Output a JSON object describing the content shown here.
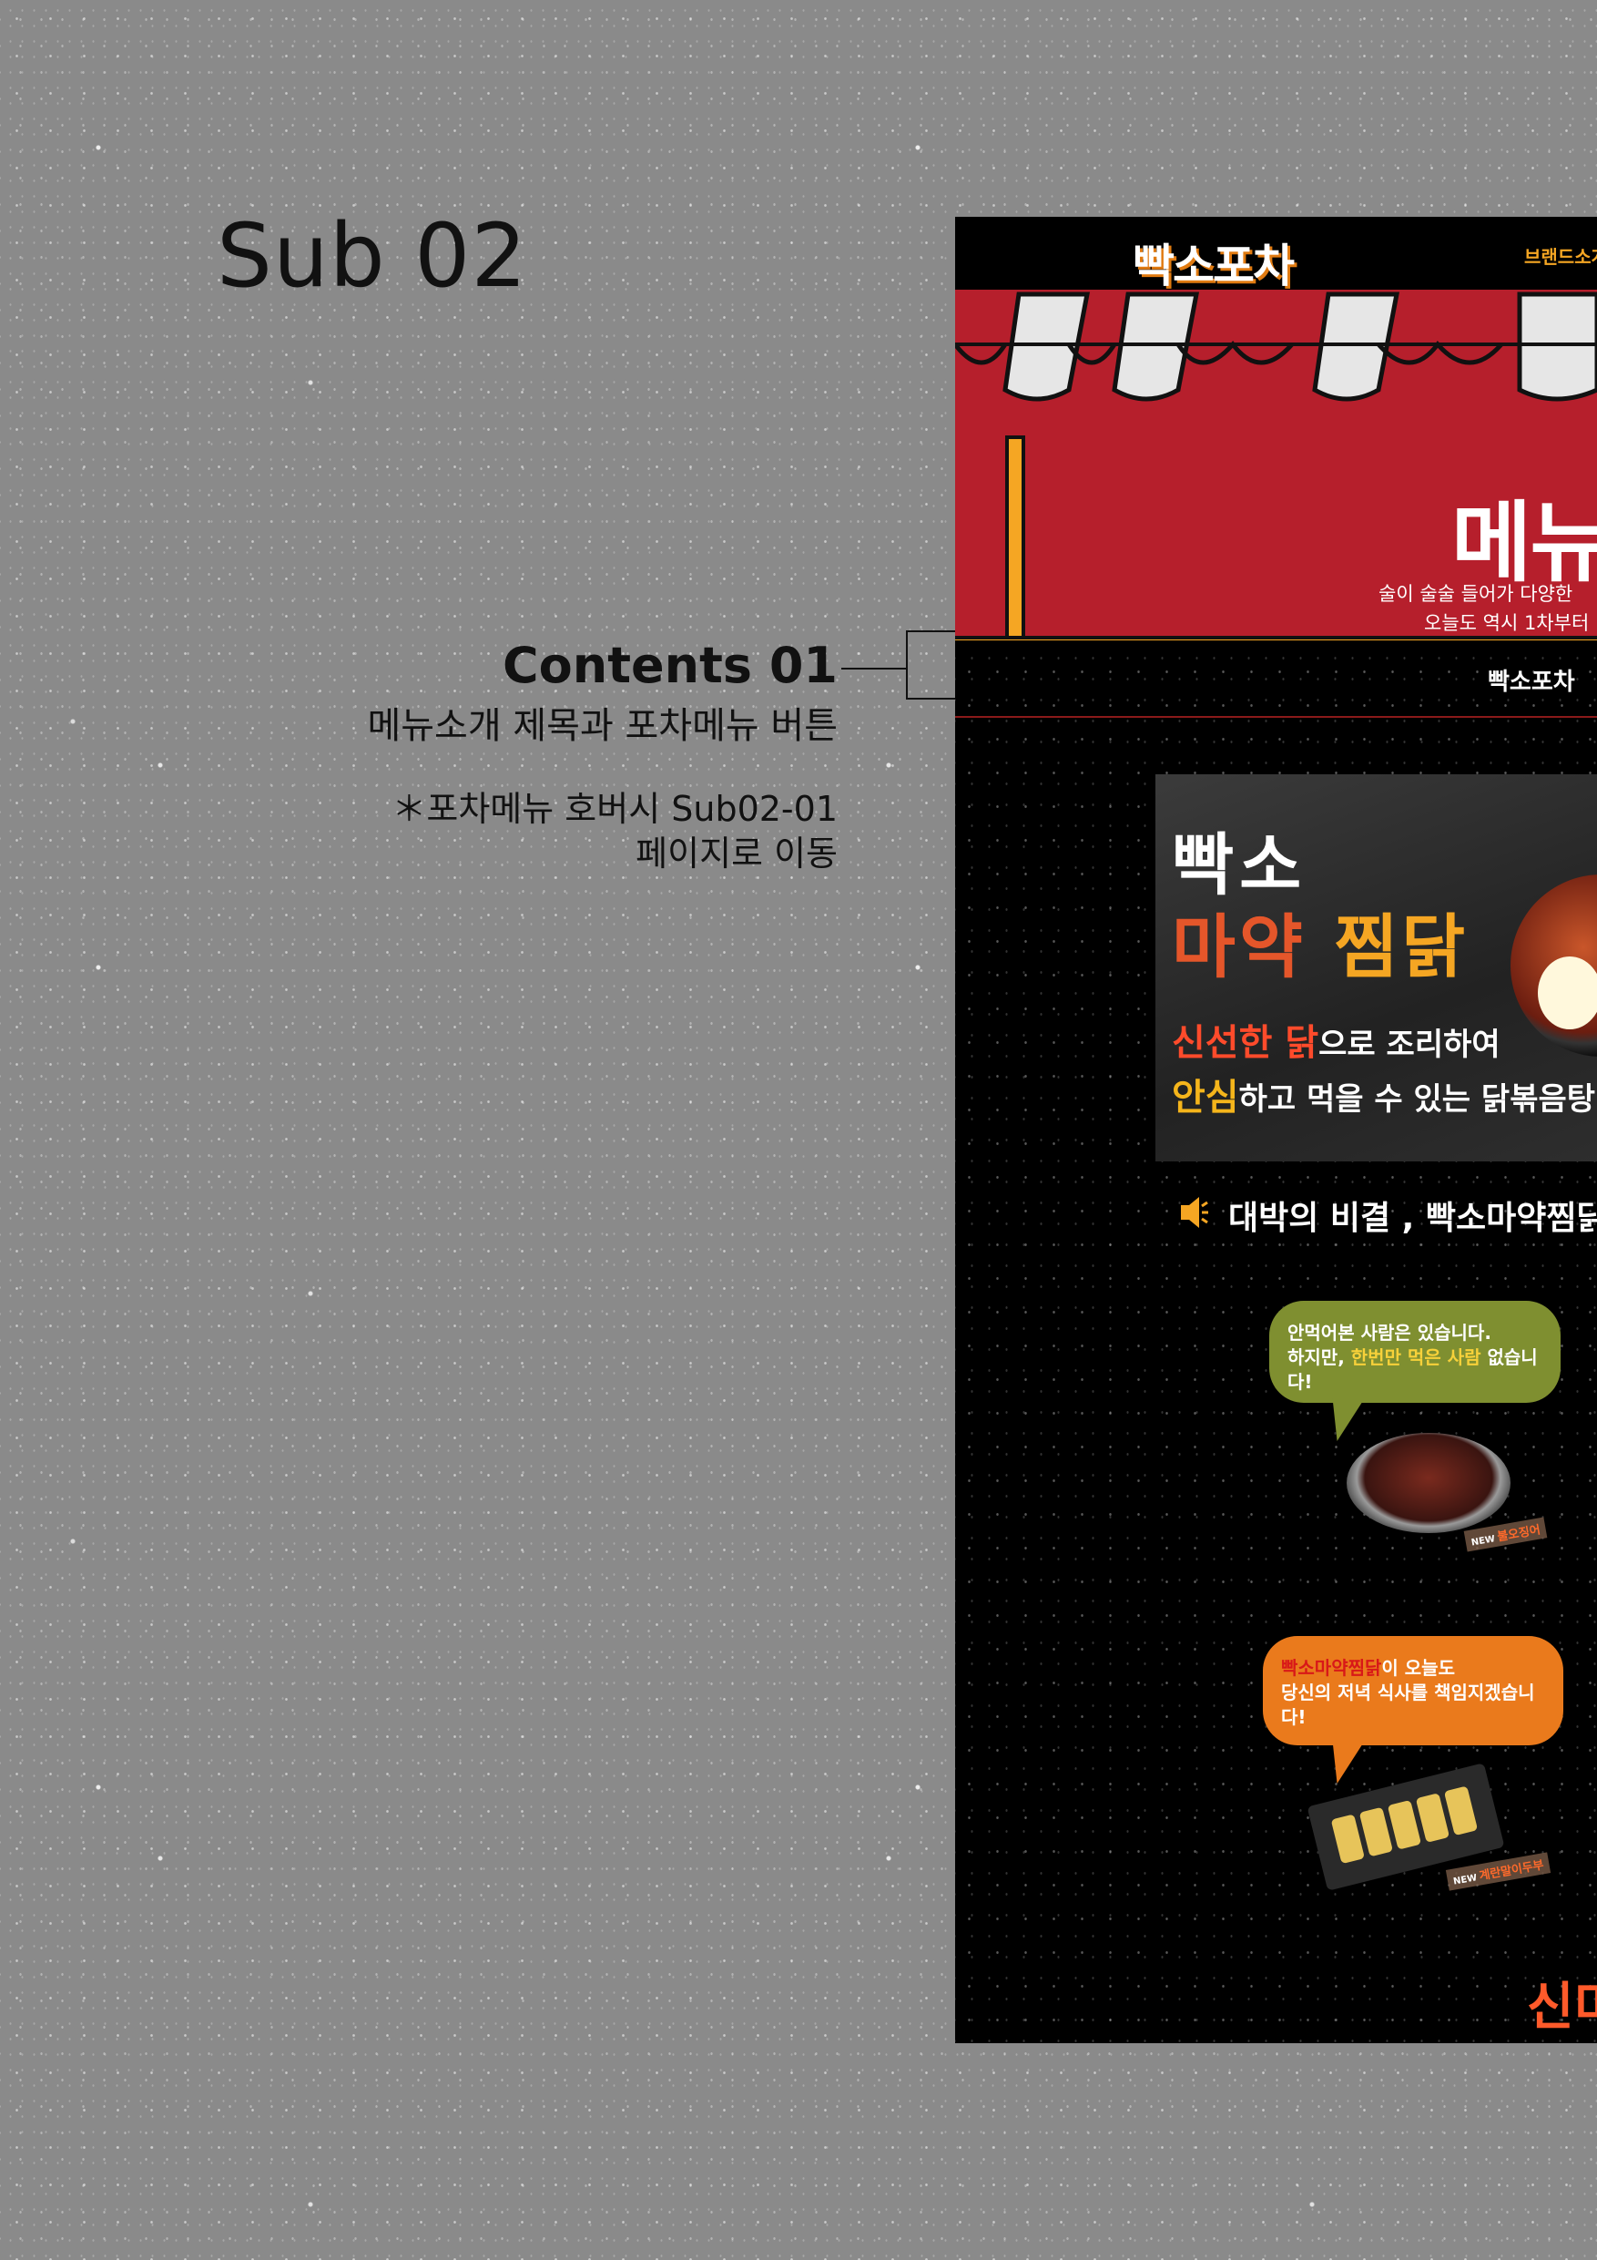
{
  "doc": {
    "title": "Sub 02",
    "annotation": {
      "label": "Contents 01",
      "description": "메뉴소개 제목과 포차메뉴 버튼",
      "note_line1": "＊포차메뉴 호버시 Sub02-01",
      "note_line2": "페이지로 이동"
    }
  },
  "site": {
    "logo": "빡소포차",
    "top_nav_text": "브랜드소개",
    "hero": {
      "title": "메뉴",
      "sub_line1": "술이 술술 들어가 다양한",
      "sub_line2": "오늘도 역시 1차부터"
    },
    "menu_button": "빡소포차",
    "promo": {
      "line1": "빡소",
      "line2_part1": "마약",
      "line2_part2": "찜닭",
      "text1_hl": "신선한 닭",
      "text1_rest": "으로 조리하여",
      "text2_hl": "안심",
      "text2_rest": "하고 먹을 수 있는 닭볶음탕"
    },
    "slogan": "대박의 비결 , 빡소마약찜닭",
    "bubble1": {
      "line1": "안먹어본 사람은 있습니다.",
      "line2_a": "하지만, ",
      "line2_hl": "한번만 먹은 사람",
      "line2_b": " 없습니다!"
    },
    "dish1_tag": {
      "new": "NEW",
      "name": "불오징어"
    },
    "bubble2": {
      "line1_hl": "빡소마약찜닭",
      "line1_rest": "이 오늘도",
      "line2": "당신의 저녁 식사를 책임지겠습니다!"
    },
    "dish2_tag": {
      "new": "NEW",
      "name": "계란말이두부"
    },
    "bottom_text": "신미"
  },
  "colors": {
    "banner_red": "#b61f2c",
    "accent_orange": "#f5a623",
    "bubble_green": "#7f8f30",
    "bubble_orange": "#ea7a1c"
  }
}
